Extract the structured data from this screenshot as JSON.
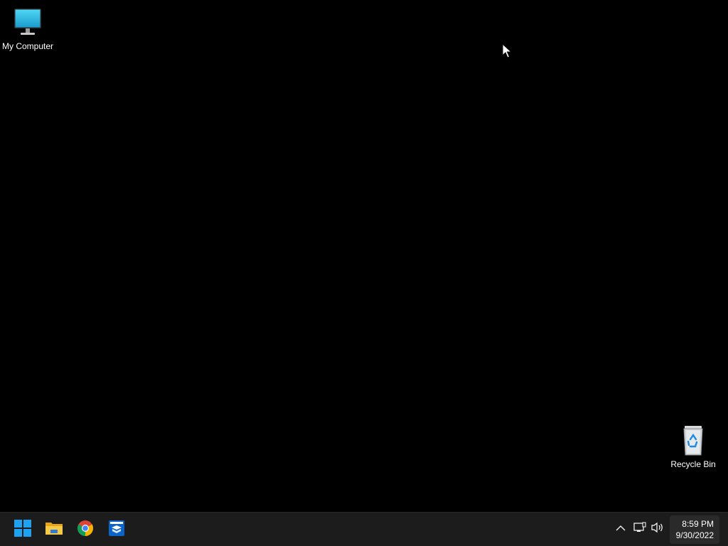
{
  "desktop": {
    "background_color": "#000000",
    "icons": [
      {
        "label": "My Computer",
        "icon": "monitor-icon"
      },
      {
        "label": "Recycle Bin",
        "icon": "recycle-bin-icon"
      }
    ]
  },
  "taskbar": {
    "background_color": "#1c1c1c",
    "pinned": [
      {
        "name": "Start",
        "icon": "windows-logo-icon"
      },
      {
        "name": "File Explorer",
        "icon": "folder-icon"
      },
      {
        "name": "Google Chrome",
        "icon": "chrome-icon"
      },
      {
        "name": "App",
        "icon": "app-box-icon"
      }
    ],
    "tray": {
      "icons": [
        "chevron-up-icon",
        "network-icon",
        "volume-icon"
      ]
    },
    "clock": {
      "time": "8:59 PM",
      "date": "9/30/2022"
    }
  },
  "colors": {
    "accent_blue": "#0078d4",
    "folder_yellow": "#f4c542"
  }
}
